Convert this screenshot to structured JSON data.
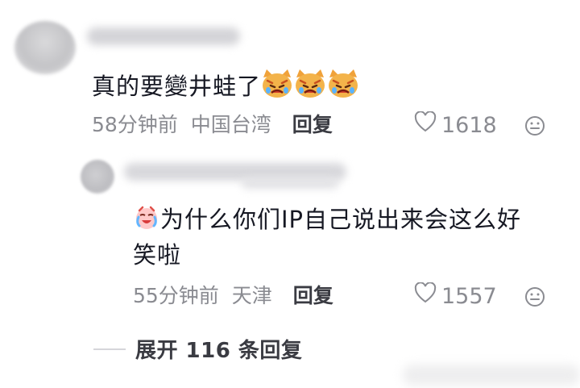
{
  "comments": [
    {
      "text": "真的要變井蛙了",
      "emoji": "cat-crying-icon",
      "time": "58分钟前",
      "location": "中国台湾",
      "reply_label": "回复",
      "likes": "1618"
    },
    {
      "text": "为什么你们IP自己说出来会这么好笑啦",
      "emoji": "laugh-crying-icon",
      "time": "55分钟前",
      "location": "天津",
      "reply_label": "回复",
      "likes": "1557"
    }
  ],
  "expand_replies": "展开 116 条回复"
}
